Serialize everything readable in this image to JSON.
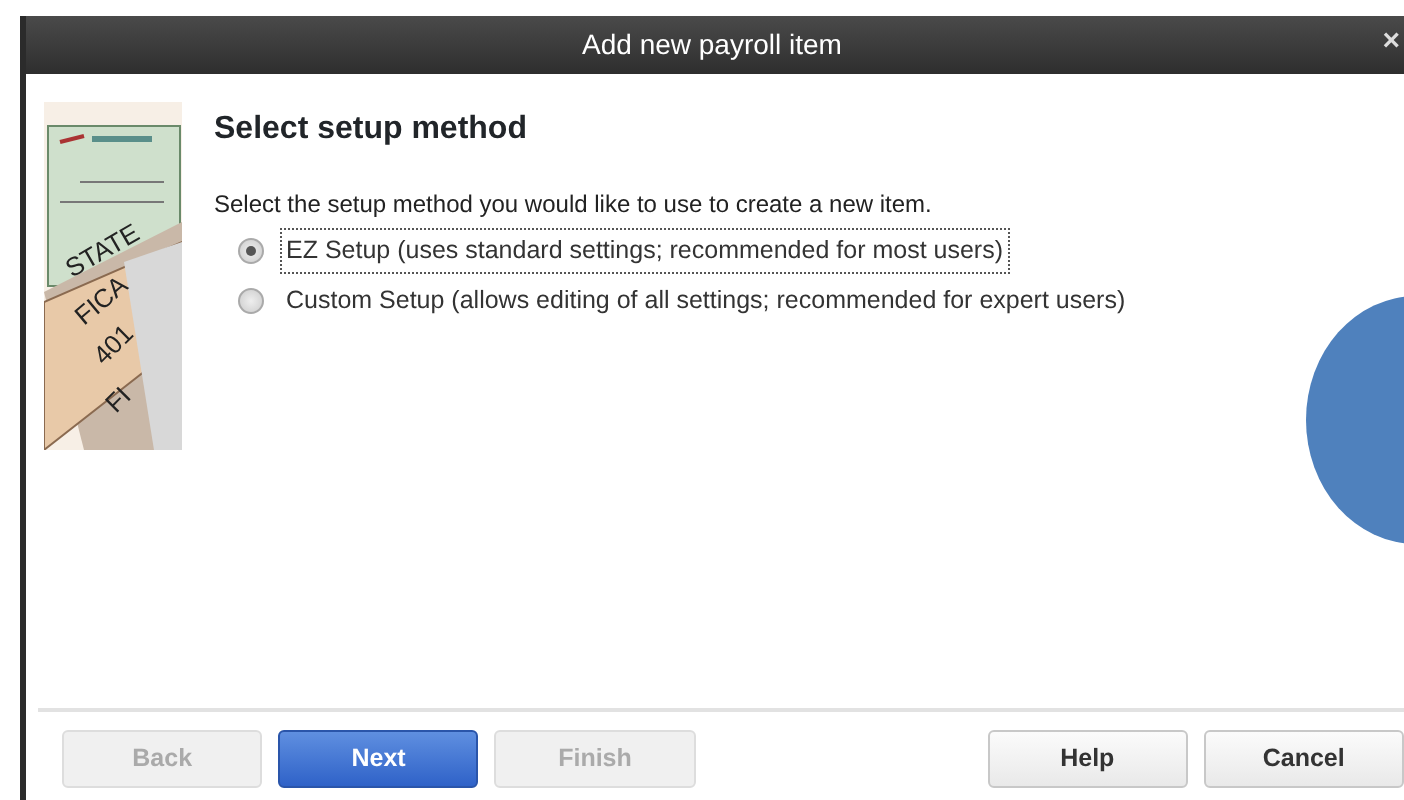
{
  "window": {
    "title": "Add new payroll item",
    "close": "×"
  },
  "heading": "Select setup method",
  "prompt": "Select the setup method you would like to use to create a new item.",
  "options": [
    {
      "label": "EZ Setup (uses standard settings; recommended for most users)",
      "selected": true
    },
    {
      "label": "Custom Setup (allows editing of all settings; recommended for expert users)",
      "selected": false
    }
  ],
  "illustration": {
    "labels": [
      "STATE",
      "FICA",
      "401",
      "FI"
    ]
  },
  "buttons": [
    {
      "label": "Back",
      "kind": "default",
      "disabled": true
    },
    {
      "label": "Next",
      "kind": "primary",
      "disabled": false
    },
    {
      "label": "Finish",
      "kind": "default",
      "disabled": true
    },
    {
      "label": "Help",
      "kind": "right",
      "disabled": false
    },
    {
      "label": "Cancel",
      "kind": "right",
      "disabled": false
    }
  ]
}
